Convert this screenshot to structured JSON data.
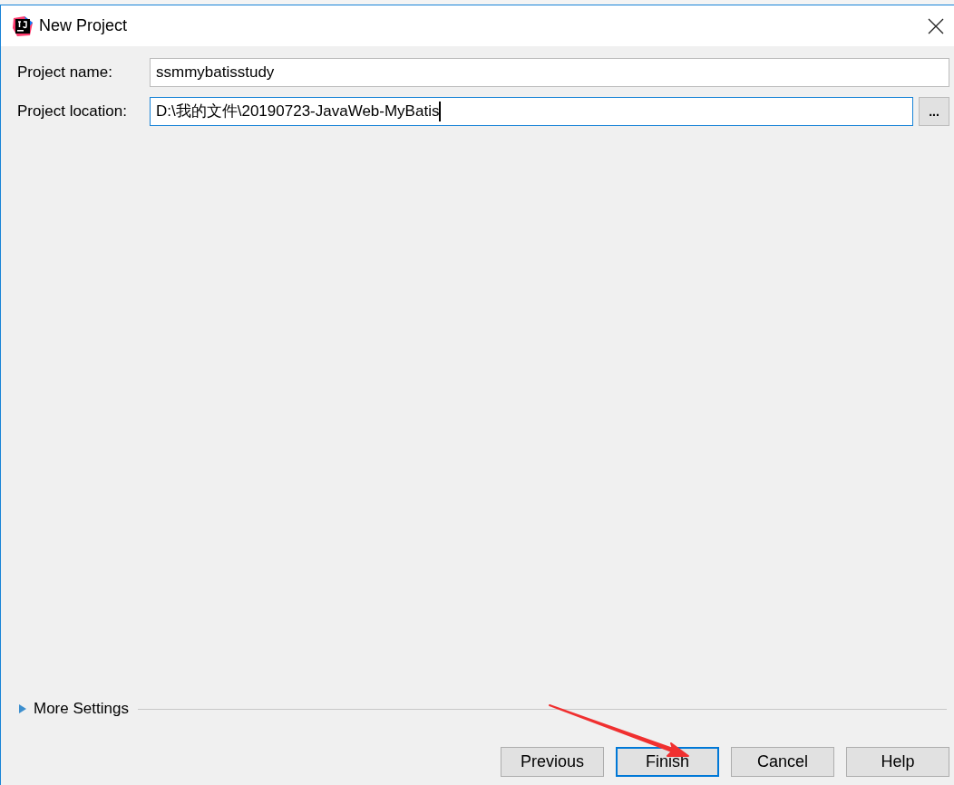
{
  "window": {
    "title": "New Project"
  },
  "fields": [
    {
      "label": "Project name:",
      "value": "ssmmybatisstudy",
      "focused": false
    },
    {
      "label": "Project location:",
      "value": "D:\\我的文件\\20190723-JavaWeb-MyBatis",
      "focused": true,
      "browse_label": "..."
    }
  ],
  "more_settings": {
    "label": "More Settings",
    "expanded": false
  },
  "buttons": [
    {
      "label": "Previous",
      "default": false
    },
    {
      "label": "Finish",
      "default": true
    },
    {
      "label": "Cancel",
      "default": false
    },
    {
      "label": "Help",
      "default": false
    }
  ]
}
